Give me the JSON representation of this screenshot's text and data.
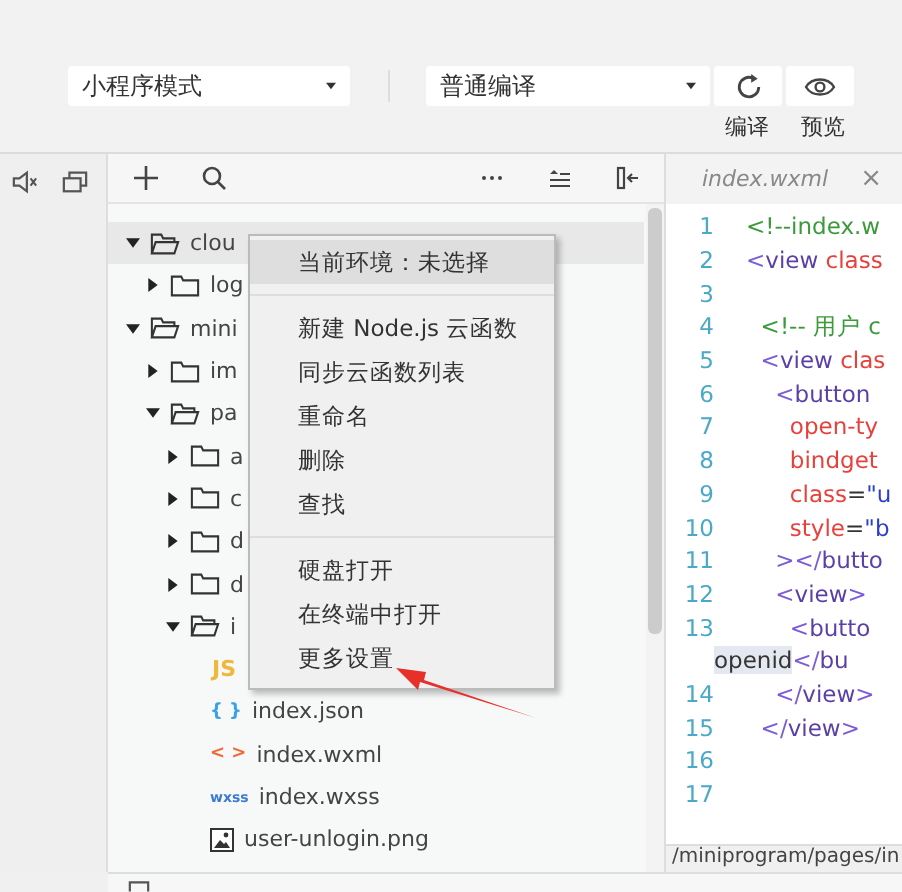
{
  "toolbar": {
    "mode_select": {
      "value": "小程序模式"
    },
    "compile_select": {
      "value": "普通编译"
    },
    "buttons": [
      {
        "kind": "refresh",
        "label": "编译"
      },
      {
        "kind": "preview",
        "label": "预览"
      }
    ]
  },
  "file_tree": {
    "items": [
      {
        "kind": "folder",
        "name": "clou",
        "expanded": true,
        "selected": true,
        "children": [
          {
            "kind": "folder",
            "name": "log",
            "expanded": false
          }
        ]
      },
      {
        "kind": "folder",
        "name": "mini",
        "expanded": true,
        "selected": false,
        "children": [
          {
            "kind": "folder",
            "name": "im",
            "expanded": false
          },
          {
            "kind": "folder",
            "name": "pa",
            "expanded": true,
            "children": [
              {
                "kind": "folder",
                "name": "a",
                "expanded": false
              },
              {
                "kind": "folder",
                "name": "c",
                "expanded": false
              },
              {
                "kind": "folder",
                "name": "d",
                "expanded": false
              },
              {
                "kind": "folder",
                "name": "d",
                "expanded": false
              },
              {
                "kind": "folder",
                "name": "i",
                "expanded": true,
                "children": [
                  {
                    "kind": "js",
                    "icon_text": "JS"
                  },
                  {
                    "kind": "json",
                    "icon_text": "{ }",
                    "name": "index.json"
                  },
                  {
                    "kind": "wxml",
                    "icon_text": "< >",
                    "name": "index.wxml"
                  },
                  {
                    "kind": "wxss",
                    "icon_text": "wxss",
                    "name": "index.wxss"
                  },
                  {
                    "kind": "image",
                    "name": "user-unlogin.png"
                  }
                ]
              }
            ]
          }
        ]
      }
    ]
  },
  "context_menu": {
    "groups": [
      [
        {
          "label": "当前环境：未选择",
          "selected": true
        }
      ],
      [
        {
          "label": "新建 Node.js 云函数",
          "selected": false
        },
        {
          "label": "同步云函数列表",
          "selected": false
        },
        {
          "label": "重命名",
          "selected": false
        },
        {
          "label": "删除",
          "selected": false
        },
        {
          "label": "查找",
          "selected": false
        }
      ],
      [
        {
          "label": "硬盘打开",
          "selected": false
        },
        {
          "label": "在终端中打开",
          "selected": false
        },
        {
          "label": "更多设置",
          "selected": false
        }
      ]
    ]
  },
  "editor": {
    "tab": {
      "title": "index.wxml",
      "close": "×"
    },
    "lines": [
      {
        "number": "1",
        "segments": [
          {
            "kind": "comment",
            "text": "<!--index.w"
          }
        ]
      },
      {
        "number": "2",
        "segments": [
          {
            "kind": "bracket",
            "text": "<"
          },
          {
            "kind": "tag",
            "text": "view "
          },
          {
            "kind": "attr",
            "text": "class"
          }
        ]
      },
      {
        "number": "3"
      },
      {
        "number": "4",
        "segments": [
          {
            "kind": "comment",
            "text": "  <!-- 用户 c"
          }
        ]
      },
      {
        "number": "5",
        "segments": [
          {
            "kind": "bracket",
            "text": "  <"
          },
          {
            "kind": "tag",
            "text": "view "
          },
          {
            "kind": "attr",
            "text": "clas"
          }
        ]
      },
      {
        "number": "6",
        "segments": [
          {
            "kind": "bracket",
            "text": "    <"
          },
          {
            "kind": "tag",
            "text": "button"
          }
        ]
      },
      {
        "number": "7",
        "segments": [
          {
            "kind": "attr",
            "text": "      open-ty"
          }
        ]
      },
      {
        "number": "8",
        "segments": [
          {
            "kind": "attr",
            "text": "      bindget"
          }
        ]
      },
      {
        "number": "9",
        "segments": [
          {
            "kind": "attr",
            "text": "      class"
          },
          {
            "kind": "plain",
            "text": "="
          },
          {
            "kind": "string",
            "text": "\"u"
          }
        ]
      },
      {
        "number": "10",
        "segments": [
          {
            "kind": "attr",
            "text": "      style"
          },
          {
            "kind": "plain",
            "text": "="
          },
          {
            "kind": "string",
            "text": "\"b"
          }
        ]
      },
      {
        "number": "11",
        "segments": [
          {
            "kind": "bracket",
            "text": "    ></"
          },
          {
            "kind": "tag",
            "text": "butto"
          }
        ]
      },
      {
        "number": "12",
        "segments": [
          {
            "kind": "bracket",
            "text": "    <"
          },
          {
            "kind": "tag",
            "text": "view"
          },
          {
            "kind": "bracket",
            "text": ">"
          }
        ]
      },
      {
        "number": "13",
        "segments": [
          {
            "kind": "bracket",
            "text": "      <"
          },
          {
            "kind": "tag",
            "text": "butto"
          }
        ]
      },
      {
        "segments": [
          {
            "kind": "match",
            "text": "openid"
          },
          {
            "kind": "bracket",
            "text": "</"
          },
          {
            "kind": "tag",
            "text": "bu"
          }
        ]
      },
      {
        "number": "14",
        "segments": [
          {
            "kind": "bracket",
            "text": "    </"
          },
          {
            "kind": "tag",
            "text": "view"
          },
          {
            "kind": "bracket",
            "text": ">"
          }
        ]
      },
      {
        "number": "15",
        "segments": [
          {
            "kind": "bracket",
            "text": "  </"
          },
          {
            "kind": "tag",
            "text": "view"
          },
          {
            "kind": "bracket",
            "text": ">"
          }
        ]
      },
      {
        "number": "16"
      },
      {
        "number": "17"
      }
    ],
    "path": "/miniprogram/pages/in"
  }
}
